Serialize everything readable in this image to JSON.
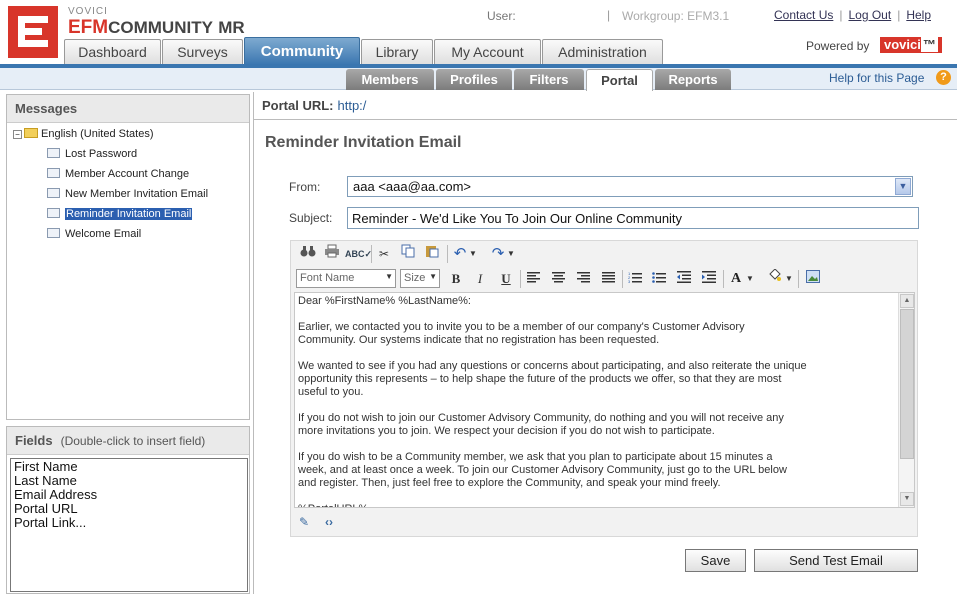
{
  "brand": {
    "vendor": "VOVICI",
    "product_efm": "EFM",
    "product_community": "COMMUNITY",
    "product_mr": "MR"
  },
  "header": {
    "user_label": "User:",
    "workgroup": "Workgroup: EFM3.1",
    "links": [
      "Contact Us",
      "Log Out",
      "Help"
    ],
    "powered_by": "Powered by",
    "powered_brand_main": "vovici",
    "powered_brand_tail": "™"
  },
  "main_tabs": [
    "Dashboard",
    "Surveys",
    "Community",
    "Library",
    "My Account",
    "Administration"
  ],
  "active_main_tab": "Community",
  "sub_tabs": [
    "Members",
    "Profiles",
    "Filters",
    "Portal",
    "Reports"
  ],
  "active_sub_tab": "Portal",
  "help_page": "Help for this Page",
  "messages": {
    "title": "Messages",
    "root": "English (United States)",
    "items": [
      "Lost Password",
      "Member Account Change",
      "New Member Invitation Email",
      "Reminder Invitation Email",
      "Welcome Email"
    ],
    "selected": "Reminder Invitation Email"
  },
  "fields": {
    "title": "Fields",
    "hint": "(Double-click to insert field)",
    "items": [
      "First Name",
      "Last Name",
      "Email Address",
      "Portal URL",
      "Portal Link..."
    ]
  },
  "portal": {
    "label": "Portal URL:",
    "url": "http:/"
  },
  "form": {
    "title": "Reminder Invitation Email",
    "from_label": "From:",
    "from_value": "aaa <aaa@aa.com>",
    "subject_label": "Subject:",
    "subject_value": "Reminder - We'd Like You To Join Our Online Community"
  },
  "editor": {
    "font_name_placeholder": "Font Name",
    "font_size_placeholder": "Size",
    "body": "Dear %FirstName% %LastName%:\n\nEarlier, we contacted you to invite you to be a member of our company's Customer Advisory\nCommunity. Our systems indicate that no registration has been requested.\n\nWe wanted to see if you had any questions or concerns about participating, and also reiterate the unique\nopportunity this represents – to help shape the future of the products we offer, so that they are most\nuseful to you.\n\nIf you do not wish to join our Customer Advisory Community, do nothing and you will not receive any\nmore invitations you to join. We respect your decision if you do not wish to participate.\n\nIf you do wish to be a Community member, we ask that you plan to participate about 15 minutes a\nweek, and at least once a week. To join our Customer Advisory Community, just go to the URL below\nand register. Then, just feel free to explore the Community, and speak your mind freely.\n\n%PortalURL%"
  },
  "buttons": {
    "save": "Save",
    "send_test": "Send Test Email"
  },
  "icons": {
    "find": "binoculars-icon",
    "print": "printer-icon",
    "spell": "spellcheck-icon",
    "cut": "scissors-icon",
    "copy": "copy-icon",
    "paste": "paste-icon",
    "undo": "undo-icon",
    "redo": "redo-icon",
    "bold": "B",
    "italic": "I",
    "underline": "U",
    "font_color": "A",
    "highlight": "paint-bucket-icon",
    "image": "image-icon"
  },
  "colors": {
    "accent_blue": "#3a76b0",
    "brand_red": "#d8352a",
    "selected_row": "#2b5fb0"
  }
}
